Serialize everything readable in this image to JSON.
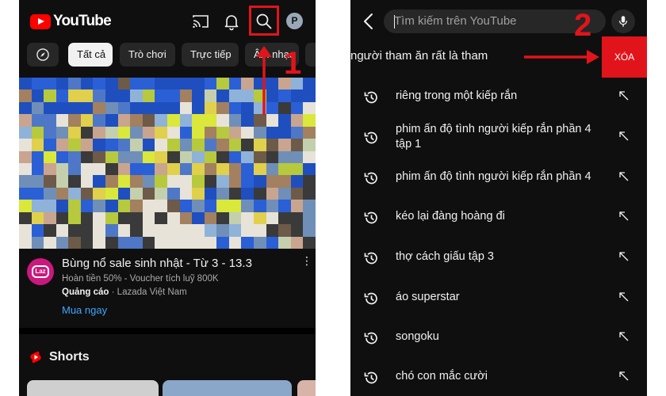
{
  "left": {
    "logo_text": "YouTube",
    "avatar_letter": "P",
    "chips": [
      {
        "label": "Tất cả",
        "active": true
      },
      {
        "label": "Trò chơi",
        "active": false
      },
      {
        "label": "Trực tiếp",
        "active": false
      },
      {
        "label": "Âm nhạc",
        "active": false
      }
    ],
    "ad": {
      "avatar_text": "Laz",
      "title": "Bùng nổ sale sinh nhật - Từ 3 - 13.3",
      "subtitle": "Hoàn tiền 50% - Voucher tích luỹ 800K",
      "sponsored_label": "Quảng cáo",
      "advertiser": "Lazada Việt Nam",
      "cta": "Mua ngay"
    },
    "shorts_label": "Shorts"
  },
  "right": {
    "search_placeholder": "Tìm kiếm trên YouTube",
    "delete_row_text": "người tham ăn rất là tham",
    "delete_button": "XÓA",
    "history": [
      "riêng trong một kiếp rắn",
      "phim ấn độ tình người kiếp rắn phần 4 tập 1",
      "phim ấn độ tình người kiếp rắn phần 4",
      "kéo lại đàng hoàng đi",
      "thợ cách giấu tập 3",
      "áo superstar",
      "songoku",
      "chó con mắc cười"
    ]
  },
  "annotations": {
    "step1": "1",
    "step2": "2"
  },
  "colors": {
    "app_bg": "#0f0f0f",
    "chip_bg": "#272727",
    "accent_red": "#e2141b",
    "link_blue": "#3ea6ff"
  }
}
